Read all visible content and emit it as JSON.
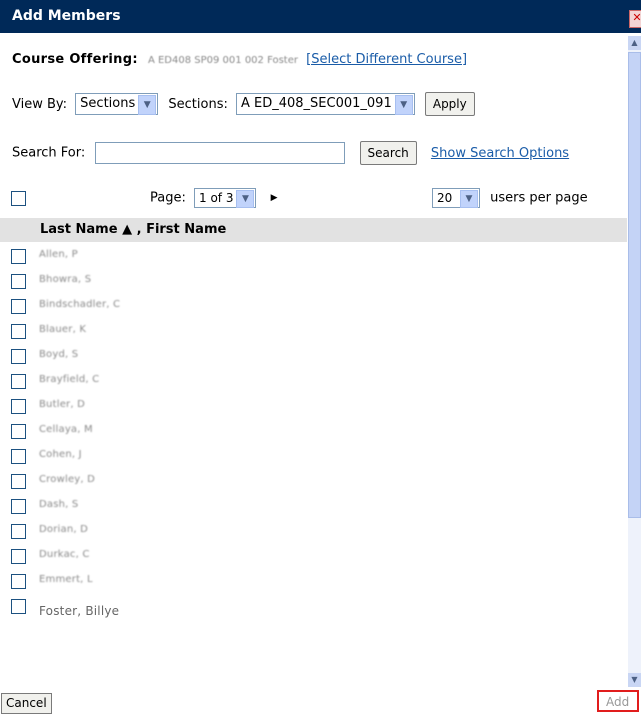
{
  "window": {
    "title": "Add Members",
    "close_glyph": "✕"
  },
  "course": {
    "label": "Course Offering:",
    "value": "A ED408 SP09 001 002 Foster",
    "change_link": "[Select Different Course]"
  },
  "view": {
    "view_by_label": "View By:",
    "view_by_value": "Sections",
    "sections_label": "Sections:",
    "sections_value": "A ED_408_SEC001_091",
    "apply_label": "Apply"
  },
  "search": {
    "label": "Search For:",
    "value": "",
    "button": "Search",
    "options_link": "Show Search Options"
  },
  "pager": {
    "page_label": "Page:",
    "page_value": "1 of 3",
    "per_page_value": "20",
    "per_page_label": "users per page"
  },
  "table": {
    "column_header": "Last Name ▲ , First Name",
    "rows": [
      "Allen, P",
      "Bhowra, S",
      "Bindschadler, C",
      "Blauer, K",
      "Boyd, S",
      "Brayfield, C",
      "Butler, D",
      "Cellaya, M",
      "Cohen, J",
      "Crowley, D",
      "Dash, S",
      "Dorian, D",
      "Durkac, C",
      "Emmert, L",
      "Foster, Billye"
    ]
  },
  "footer": {
    "cancel_label": "Cancel",
    "add_label": "Add"
  },
  "colors": {
    "titlebar": "#002958",
    "link": "#1a5ca8",
    "highlight": "#e11d1d"
  }
}
